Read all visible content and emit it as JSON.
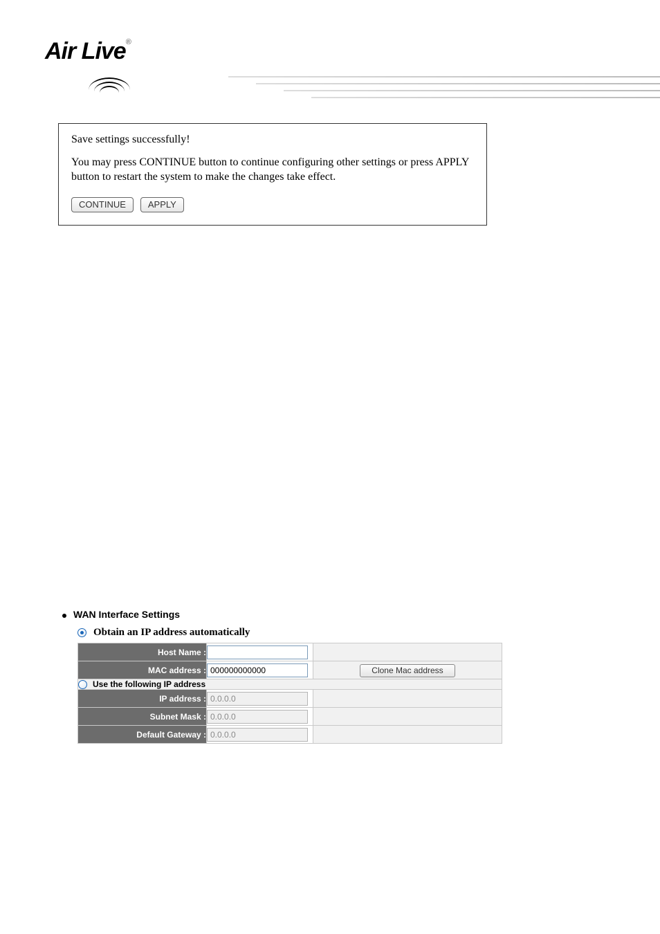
{
  "brand": {
    "name": "Air Live"
  },
  "dialog": {
    "success_message": "Save settings successfully!",
    "instructions": "You may press CONTINUE button to continue configuring other settings or press APPLY button to restart the system to make the changes take effect.",
    "continue_label": "CONTINUE",
    "apply_label": "APPLY"
  },
  "wan": {
    "section_title": "WAN Interface Settings",
    "auto_ip_label": "Obtain an IP address automatically",
    "static_ip_label": "Use the following IP address",
    "host_name_label": "Host Name :",
    "host_name_value": "",
    "mac_label": "MAC address :",
    "mac_value": "000000000000",
    "clone_label": "Clone Mac address",
    "ip_label": "IP address :",
    "ip_value": "0.0.0.0",
    "subnet_label": "Subnet Mask :",
    "subnet_value": "0.0.0.0",
    "gateway_label": "Default Gateway :",
    "gateway_value": "0.0.0.0"
  }
}
